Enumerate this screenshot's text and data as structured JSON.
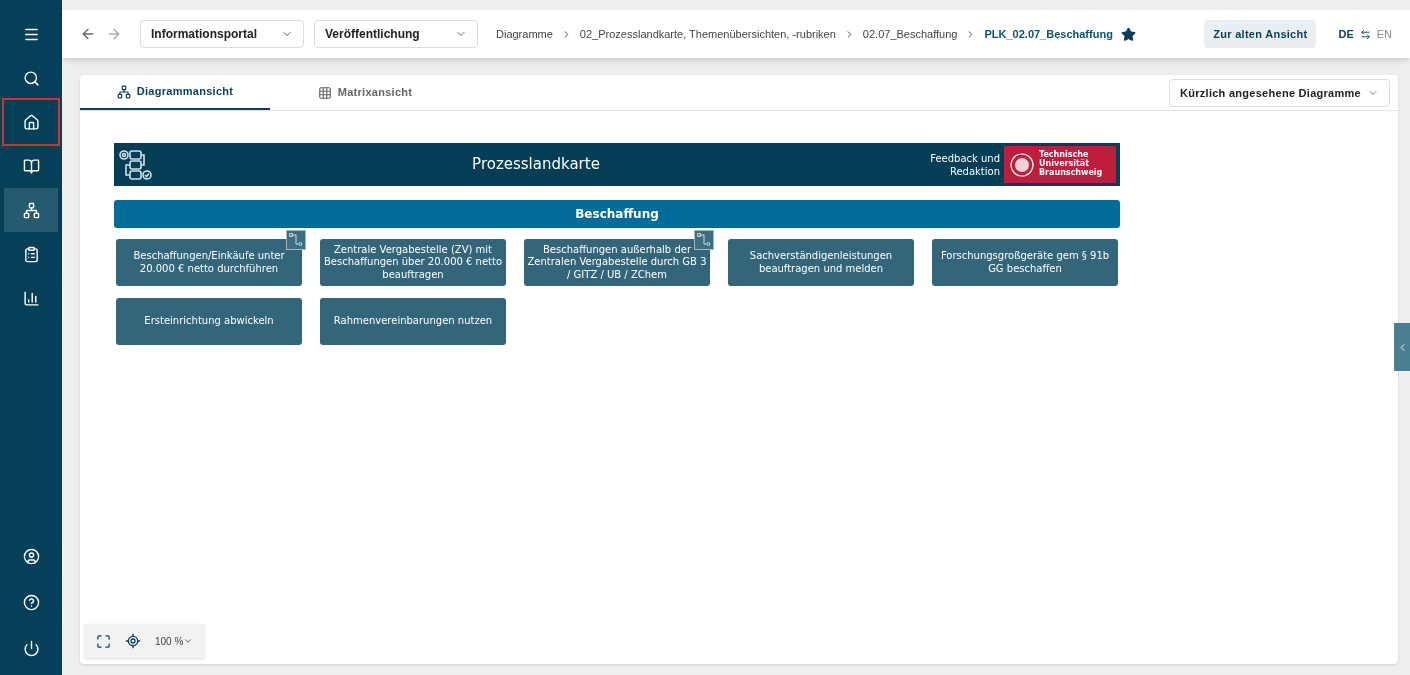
{
  "sidebar": {
    "items": [
      {
        "selected": false,
        "marked": false
      },
      {
        "selected": false,
        "marked": false
      },
      {
        "selected": false,
        "marked": true
      },
      {
        "selected": false,
        "marked": false
      },
      {
        "selected": true,
        "marked": false
      },
      {
        "selected": false,
        "marked": false
      },
      {
        "selected": false,
        "marked": false
      }
    ]
  },
  "topbar": {
    "selects": [
      {
        "value": "Informationsportal"
      },
      {
        "value": "Veröffentlichung"
      }
    ],
    "breadcrumbs": [
      {
        "label": "Diagramme",
        "current": false
      },
      {
        "label": "02_Prozesslandkarte, Themenübersichten, -rubriken",
        "current": false
      },
      {
        "label": "02.07_Beschaffung",
        "current": false
      },
      {
        "label": "PLK_02.07_Beschaffung",
        "current": true
      }
    ],
    "favorite": true,
    "old_view_button": "Zur alten Ansicht",
    "languages": [
      {
        "label": "DE",
        "selected": true
      },
      {
        "label": "EN",
        "selected": false
      }
    ]
  },
  "tabs": [
    {
      "label": "Diagrammansicht",
      "selected": true
    },
    {
      "label": "Matrixansicht",
      "selected": false
    }
  ],
  "recent_dropdown": "Kürzlich angesehene Diagramme",
  "diagram": {
    "title": "Prozesslandkarte",
    "feedback": "Feedback und Redaktion",
    "logo_text": "Technische Universität Braunschweig",
    "category": "Beschaffung",
    "processes": [
      {
        "label": "Beschaffungen/Einkäufe unter 20.000 € netto durchführen",
        "linked": true
      },
      {
        "label": "Zentrale Vergabestelle (ZV) mit Beschaffungen über 20.000 € netto beauftragen",
        "linked": false
      },
      {
        "label": "Beschaffungen außerhalb der Zentralen Vergabestelle durch GB 3 / GITZ / UB / ZChem",
        "linked": true
      },
      {
        "label": "Sachverständigenleistungen beauftragen und melden",
        "linked": false
      },
      {
        "label": "Forschungsgroßgeräte gem § 91b GG beschaffen",
        "linked": false
      },
      {
        "label": "Ersteinrichtung abwickeln",
        "linked": false
      },
      {
        "label": "Rahmenvereinbarungen nutzen",
        "linked": false
      }
    ]
  },
  "zoom": {
    "value": "100 %"
  }
}
